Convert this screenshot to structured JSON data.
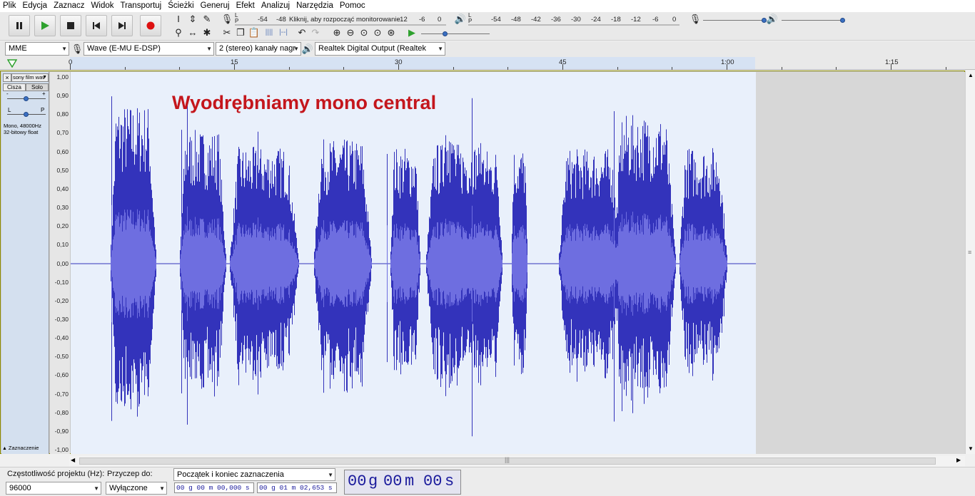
{
  "menu": [
    "Plik",
    "Edycja",
    "Zaznacz",
    "Widok",
    "Transportuj",
    "Ścieżki",
    "Generuj",
    "Efekt",
    "Analizuj",
    "Narzędzia",
    "Pomoc"
  ],
  "transport": {
    "pause": "pause-icon",
    "play": "play-icon",
    "stop": "stop-icon",
    "skip_start": "skip-start-icon",
    "skip_end": "skip-end-icon",
    "record": "record-icon"
  },
  "record_meter": {
    "channels": "L\nP",
    "ticks": [
      "-54",
      "-48",
      "Kliknij, aby rozpocząć monitorowanie",
      "-12",
      "-6",
      "0"
    ]
  },
  "play_meter": {
    "channels": "L\nP",
    "ticks": [
      "-54",
      "-48",
      "-42",
      "-36",
      "-30",
      "-24",
      "-18",
      "-12",
      "-6",
      "0"
    ]
  },
  "device": {
    "host": "MME",
    "recording": "Wave (E-MU E-DSP)",
    "channels": "2 (stereo) kanały nagr",
    "playback": "Realtek Digital Output (Realtek"
  },
  "ruler": {
    "labels": [
      "0",
      "15",
      "30",
      "45",
      "1:00",
      "1:15"
    ]
  },
  "track": {
    "name": "sony film wav",
    "mute": "Cisza",
    "solo": "Solo",
    "gain_minus": "-",
    "gain_plus": "+",
    "pan_left": "L",
    "pan_right": "P",
    "info1": "Mono, 48000Hz",
    "info2": "32-bitowy float",
    "select": "Zaznaczenie"
  },
  "yscale": [
    "1,00",
    "0,90",
    "0,80",
    "0,70",
    "0,60",
    "0,50",
    "0,40",
    "0,30",
    "0,20",
    "0,10",
    "0,00",
    "-0,10",
    "-0,20",
    "-0,30",
    "-0,40",
    "-0,50",
    "-0,60",
    "-0,70",
    "-0,80",
    "-0,90",
    "-1,00"
  ],
  "overlay_title": "Wyodrębniamy mono central",
  "status": {
    "rate_label": "Częstotliwość projektu (Hz):",
    "rate_value": "96000",
    "snap_label": "Przyczep do:",
    "snap_value": "Wyłączone",
    "sel_mode": "Początek i koniec zaznaczenia",
    "sel_start": "00 g 00 m 00,000 s",
    "sel_end": "00 g 01 m 02,653 s",
    "pos_h": "00",
    "pos_hu": "g",
    "pos_m": "00",
    "pos_mu": "m",
    "pos_s": "00",
    "pos_su": "s"
  },
  "colors": {
    "wave": "#3333bb",
    "wave_rms": "#6e6ee0",
    "title": "#c4161c",
    "selection": "#e9f0fb"
  }
}
